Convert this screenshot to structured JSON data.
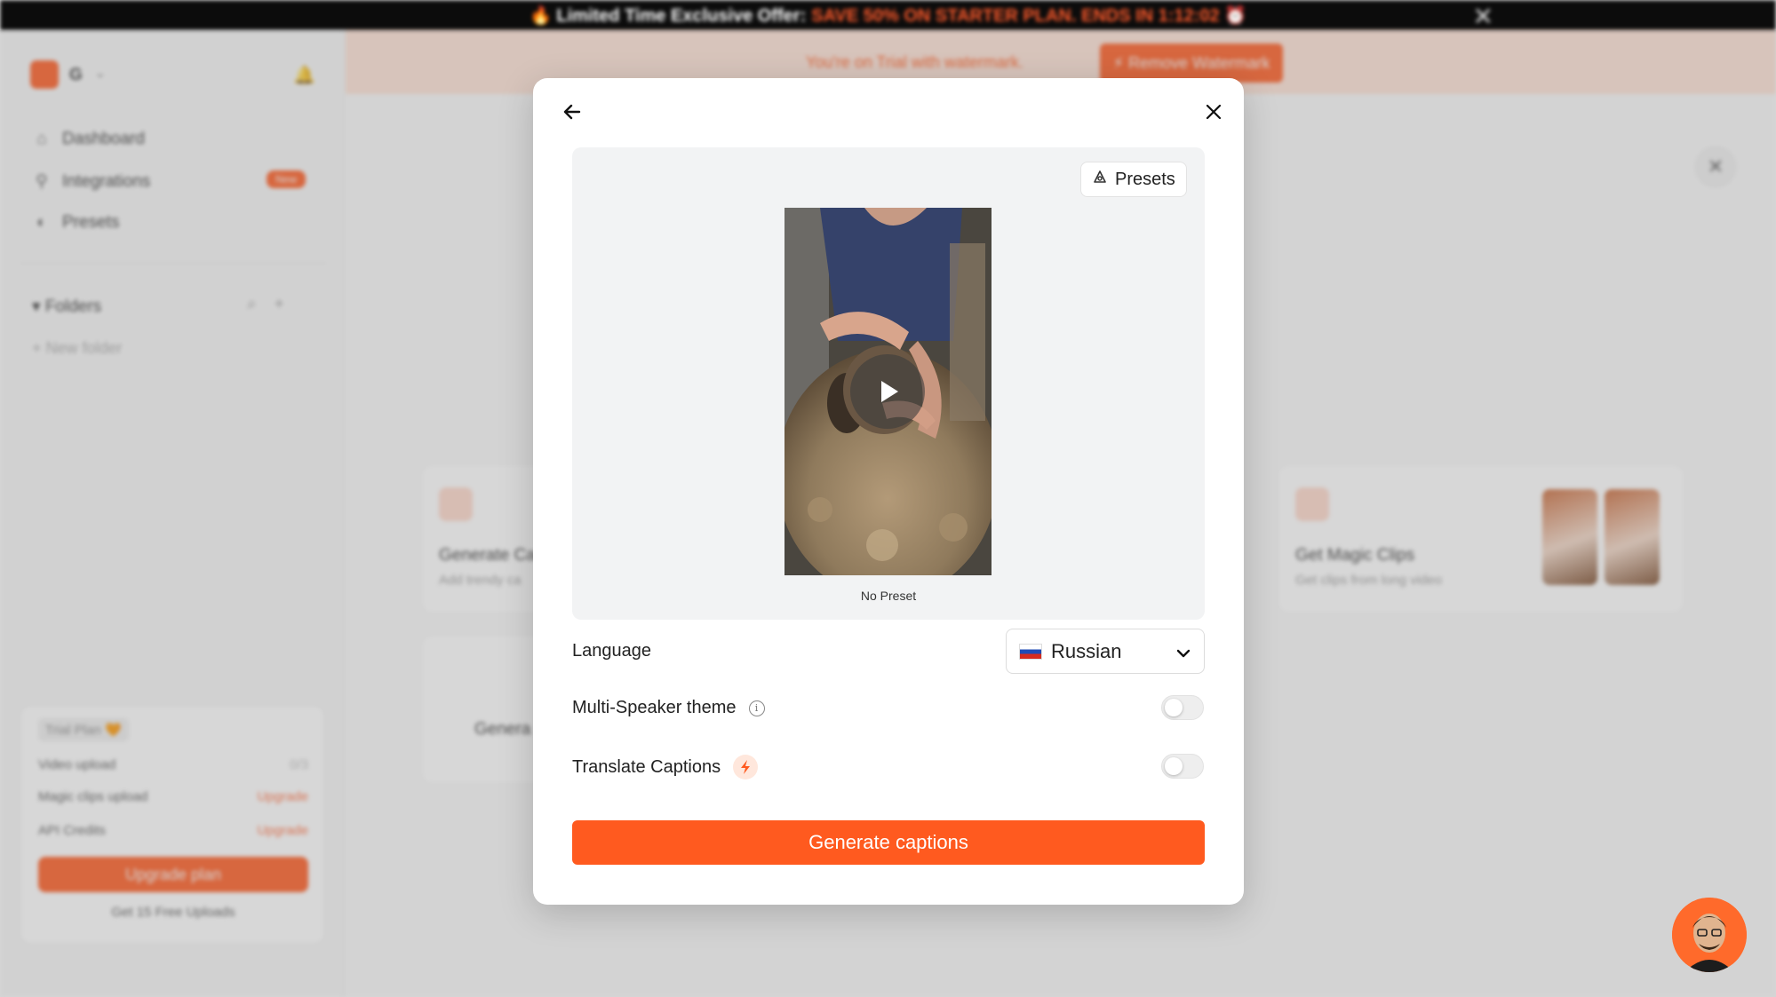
{
  "promo": {
    "text": "🔥 Limited Time Exclusive Offer:",
    "highlight": "SAVE 50% ON STARTER PLAN. ENDS IN 1:12:02 ⏰",
    "close": "✕"
  },
  "sidebar": {
    "workspace": "G",
    "nav": [
      {
        "label": "Dashboard"
      },
      {
        "label": "Integrations"
      },
      {
        "label": "Presets"
      }
    ],
    "new_badge": "New",
    "folders_label": "Folders",
    "new_folder": "New folder",
    "plan": {
      "badge": "Trial Plan 🧡",
      "rows": [
        {
          "label": "Video upload",
          "value": "0/3"
        },
        {
          "label": "Magic clips upload",
          "value": "Upgrade"
        },
        {
          "label": "API Credits",
          "value": "Upgrade"
        }
      ],
      "upgrade_button": "Upgrade plan",
      "free_uploads": "Get 15 Free Uploads"
    }
  },
  "main": {
    "trial_text": "You're on Trial with watermark.",
    "trial_button": "⚡ Remove Watermark",
    "cards": [
      {
        "title": "Generate Ca",
        "subtitle": "Add trendy ca"
      },
      {
        "title": "Genera",
        "subtitle": ""
      },
      {
        "title": "Get Magic Clips",
        "subtitle": "Get clips from long video"
      }
    ]
  },
  "modal": {
    "presets_button": "Presets",
    "preview_label": "No Preset",
    "language_label": "Language",
    "language_value": "Russian",
    "multi_speaker_label": "Multi-Speaker theme",
    "multi_speaker_on": false,
    "translate_label": "Translate Captions",
    "translate_on": false,
    "generate_button": "Generate captions"
  },
  "colors": {
    "accent": "#ff5a1f",
    "overlay": "rgba(130,130,130,0.32)"
  },
  "icons": {
    "back": "arrow-left-icon",
    "close": "close-icon",
    "presets": "palette-icon",
    "play": "play-icon",
    "language_chevron": "chevron-down-icon",
    "info": "info-icon",
    "bolt": "bolt-icon"
  }
}
